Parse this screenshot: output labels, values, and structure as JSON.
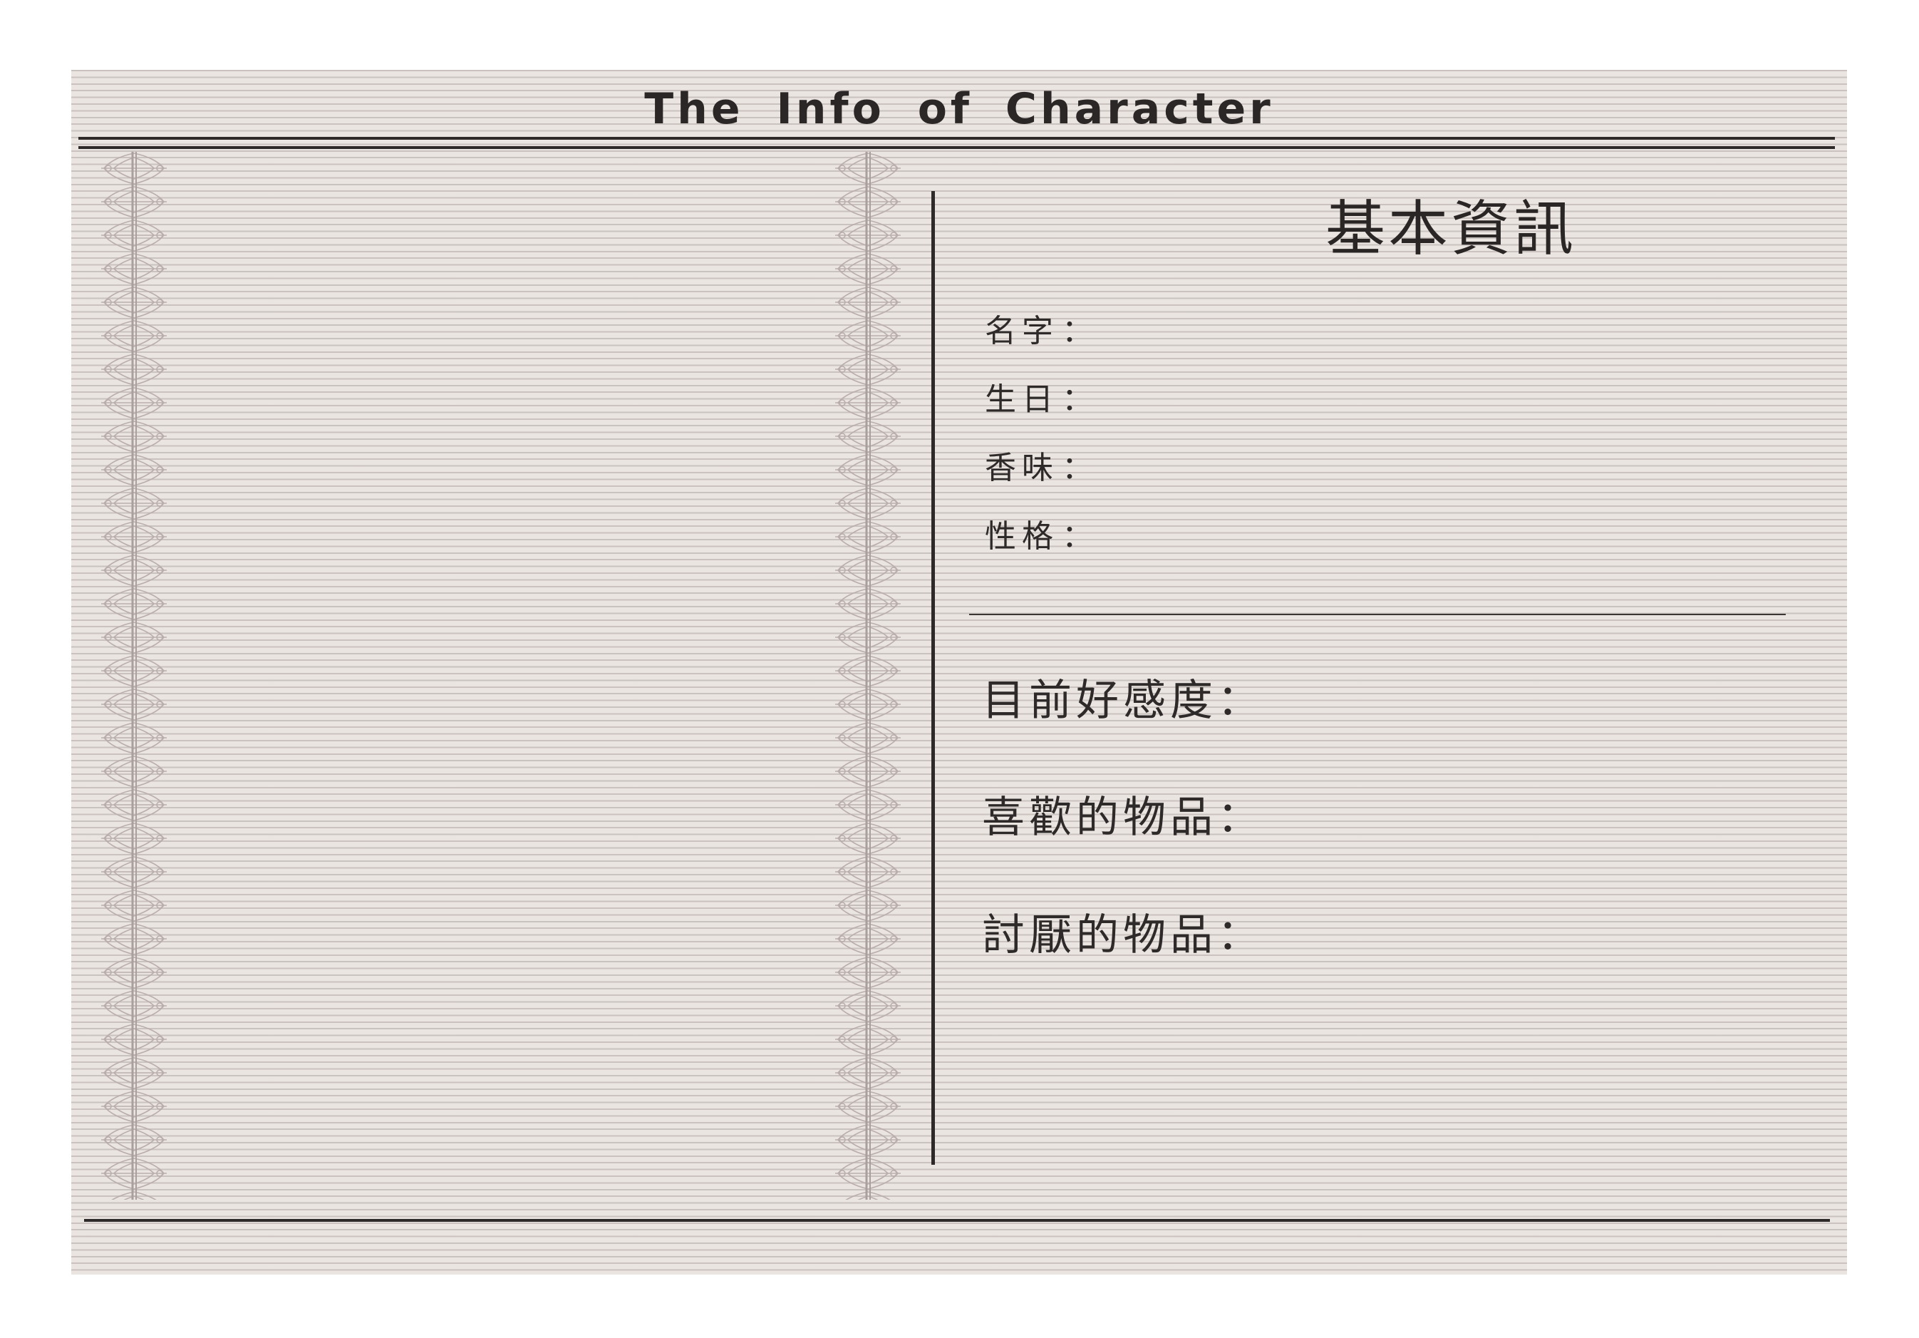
{
  "header": {
    "title": "The Info of Character"
  },
  "basic_info": {
    "section_title": "基本資訊",
    "fields": [
      {
        "label": "名字",
        "colon": "："
      },
      {
        "label": "生日",
        "colon": "："
      },
      {
        "label": "香味",
        "colon": "："
      },
      {
        "label": "性格",
        "colon": "："
      }
    ]
  },
  "extra_info": {
    "fields": [
      {
        "label": "目前好感度",
        "colon": "："
      },
      {
        "label": "喜歡的物品",
        "colon": "："
      },
      {
        "label": "討厭的物品",
        "colon": "："
      }
    ]
  },
  "colors": {
    "paper": "#ebe5e2",
    "ink": "#2e2a2a",
    "ruled_line": "#afa5a2"
  },
  "icons": [
    "ornamental-binding-left",
    "ornamental-binding-right"
  ]
}
